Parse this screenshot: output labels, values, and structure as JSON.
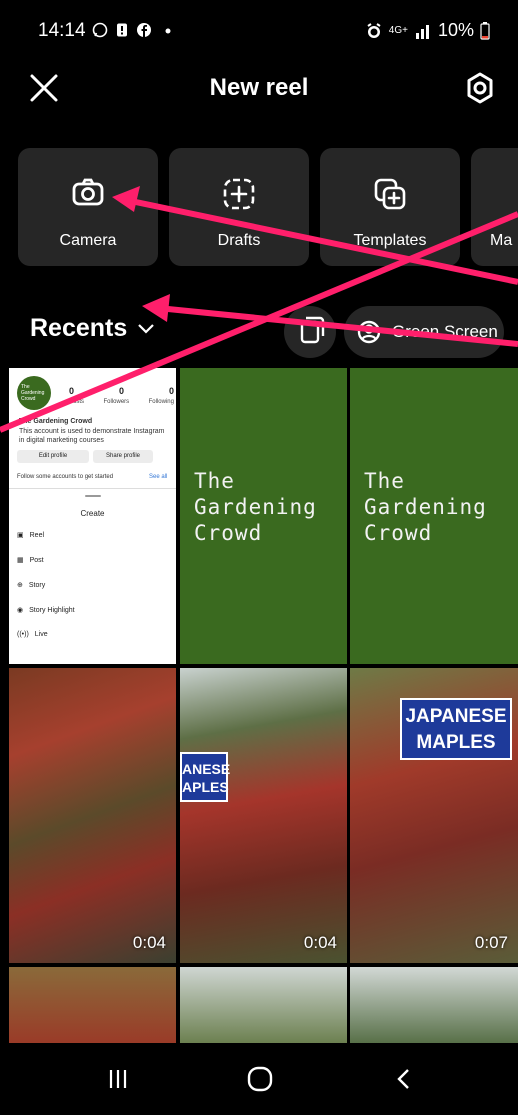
{
  "status_bar": {
    "time": "14:14",
    "network": "4G+",
    "battery": "10%"
  },
  "header": {
    "title": "New reel"
  },
  "tiles": [
    {
      "label": "Camera",
      "icon": "camera-icon"
    },
    {
      "label": "Drafts",
      "icon": "drafts-icon"
    },
    {
      "label": "Templates",
      "icon": "templates-icon"
    },
    {
      "label": "Ma",
      "icon": "more-icon"
    }
  ],
  "recents": {
    "label": "Recents",
    "green_screen_label": "Green Screen"
  },
  "grid": {
    "green_text": "The\nGardening\nCrowd",
    "durations": [
      "0:04",
      "0:04",
      "0:07"
    ],
    "sign_left": "ANESE\nAPLES",
    "sign_right": "JAPANESE\nMAPLES"
  },
  "profile_embed": {
    "avatar_text": "The\nGardening\nCrowd",
    "posts_count": "0",
    "followers_count": "0",
    "following_count": "0",
    "posts_label": "Posts",
    "followers_label": "Followers",
    "following_label": "Following",
    "name": "The Gardening Crowd",
    "bio": "This account is used to demonstrate Instagram in digital marketing courses",
    "edit_profile": "Edit profile",
    "share_profile": "Share profile",
    "follow_text": "Follow some accounts to get started",
    "see_all": "See all",
    "sheet_title": "Create",
    "sheet_items": [
      "Reel",
      "Post",
      "Story",
      "Story Highlight",
      "Live"
    ]
  },
  "colors": {
    "annotation_arrow": "#ff1f6b",
    "tile_bg": "#262626",
    "green_tile": "#3a6a1f"
  }
}
